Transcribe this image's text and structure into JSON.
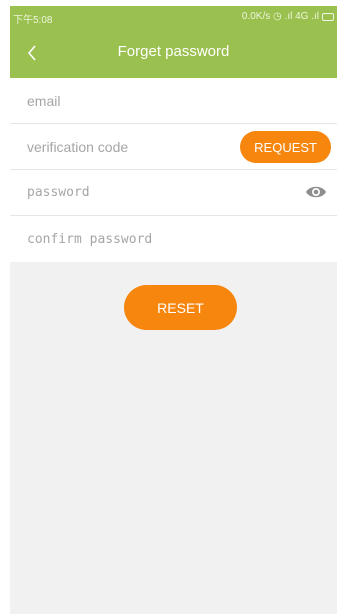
{
  "status_bar": {
    "time": "下午5:08",
    "indicators": "0.0K/s ◷ .ıl 4G .ıl"
  },
  "header": {
    "title": "Forget password",
    "back_icon": "chevron-left-icon"
  },
  "form": {
    "email_placeholder": "email",
    "code_placeholder": "verification code",
    "request_label": "REQUEST",
    "password_placeholder": "password",
    "eye_icon": "eye-icon",
    "confirm_placeholder": "confirm password"
  },
  "actions": {
    "reset_label": "RESET"
  },
  "colors": {
    "bar": "#9ac04f",
    "accent": "#f7860f",
    "background": "#f1f1f1"
  }
}
